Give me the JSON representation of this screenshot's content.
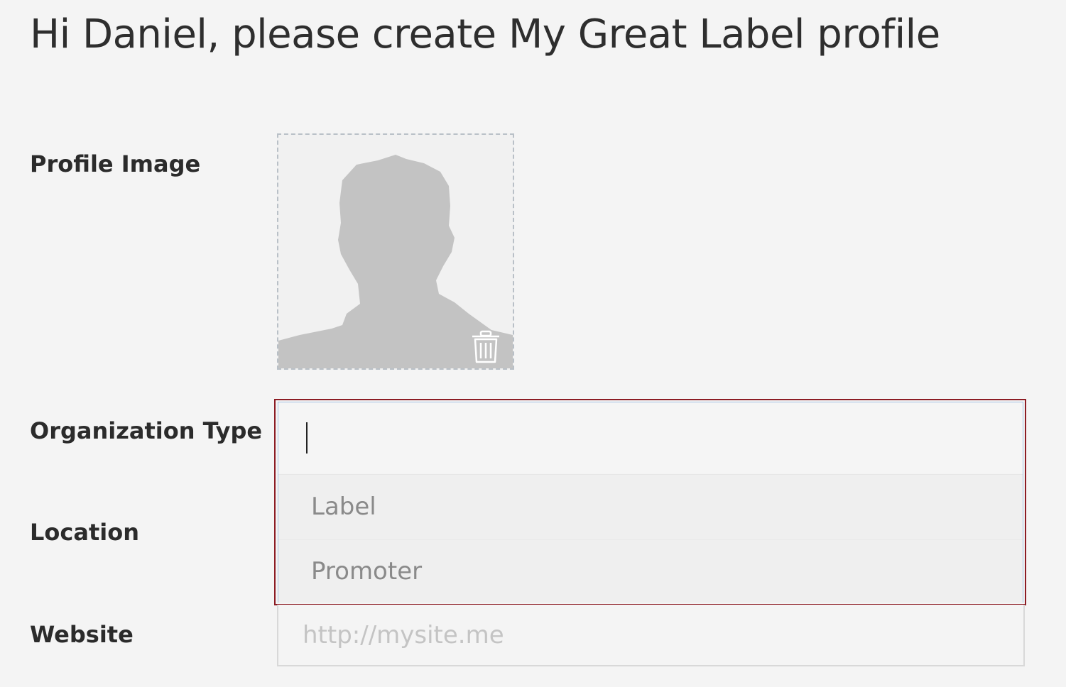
{
  "header": {
    "title": "Hi Daniel, please create My Great Label profile"
  },
  "form": {
    "profile_image": {
      "label": "Profile Image",
      "placeholder_icon": "avatar-silhouette",
      "delete_icon": "trash-icon"
    },
    "organization_type": {
      "label": "Organization Type",
      "value": "",
      "options": [
        "Label",
        "Promoter"
      ]
    },
    "location": {
      "label": "Location"
    },
    "website": {
      "label": "Website",
      "value": "",
      "placeholder": "http://mysite.me"
    }
  },
  "colors": {
    "background": "#f4f4f4",
    "focus_border": "#8c1c24",
    "inner_border": "#a9c4e4",
    "silhouette": "#c3c3c3"
  }
}
